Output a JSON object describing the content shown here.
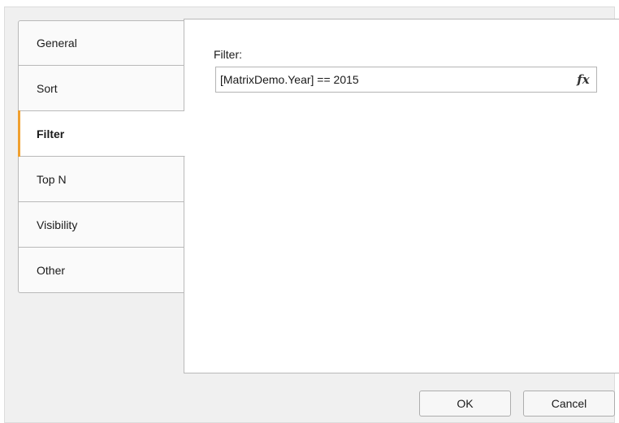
{
  "tabs": [
    {
      "label": "General"
    },
    {
      "label": "Sort"
    },
    {
      "label": "Filter"
    },
    {
      "label": "Top N"
    },
    {
      "label": "Visibility"
    },
    {
      "label": "Other"
    }
  ],
  "active_tab": "Filter",
  "filter": {
    "label": "Filter:",
    "expression": "[MatrixDemo.Year] == 2015",
    "fx_label": "fx"
  },
  "buttons": {
    "ok": "OK",
    "cancel": "Cancel"
  },
  "colors": {
    "active_tab_accent": "#f0a030",
    "dialog_background": "#f0f0f0"
  }
}
